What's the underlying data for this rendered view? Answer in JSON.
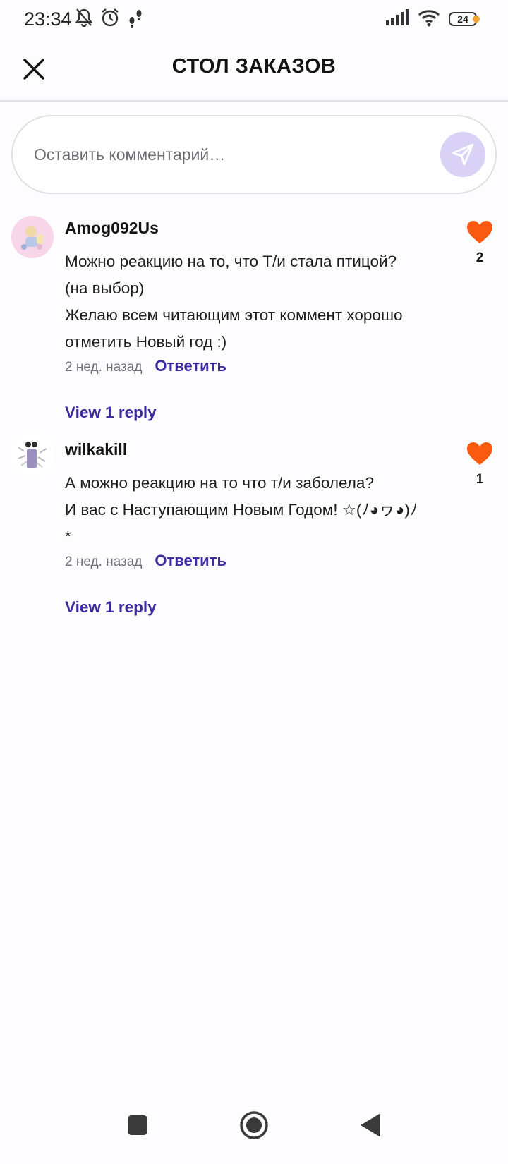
{
  "status_bar": {
    "time": "23:34",
    "battery": "24",
    "icons": [
      "bell-off-icon",
      "alarm-icon",
      "footsteps-icon",
      "signal-icon",
      "wifi-icon",
      "battery-icon"
    ]
  },
  "header": {
    "title": "СТОЛ ЗАКАЗОВ",
    "close_icon": "close-icon"
  },
  "comment_input": {
    "placeholder": "Оставить комментарий…",
    "value": "",
    "send_icon": "send-icon"
  },
  "comments": [
    {
      "username": "Amog092Us",
      "text": "Можно реакцию на то, что Т/и стала птицой?\n(на выбор)\nЖелаю всем читающим этот коммент  хорошо\nотметить Новый год :)",
      "time_ago": "2 нед. назад",
      "reply_label": "Ответить",
      "view_replies": "View 1 reply",
      "likes": "2"
    },
    {
      "username": "wilkakill",
      "text": "А можно реакцию на то что т/и заболела?\nИ вас с Наступающим Новым Годом! ☆(ﾉ◕ヮ◕)ﾉ\n*",
      "time_ago": "2 нед. назад",
      "reply_label": "Ответить",
      "view_replies": "View 1 reply",
      "likes": "1"
    }
  ],
  "colors": {
    "accent": "#3b2ba0",
    "like": "#fa5a0f",
    "send_bg": "#d9d1f6"
  },
  "nav_bar": {
    "items": [
      "recents-icon",
      "home-icon",
      "back-icon"
    ]
  }
}
